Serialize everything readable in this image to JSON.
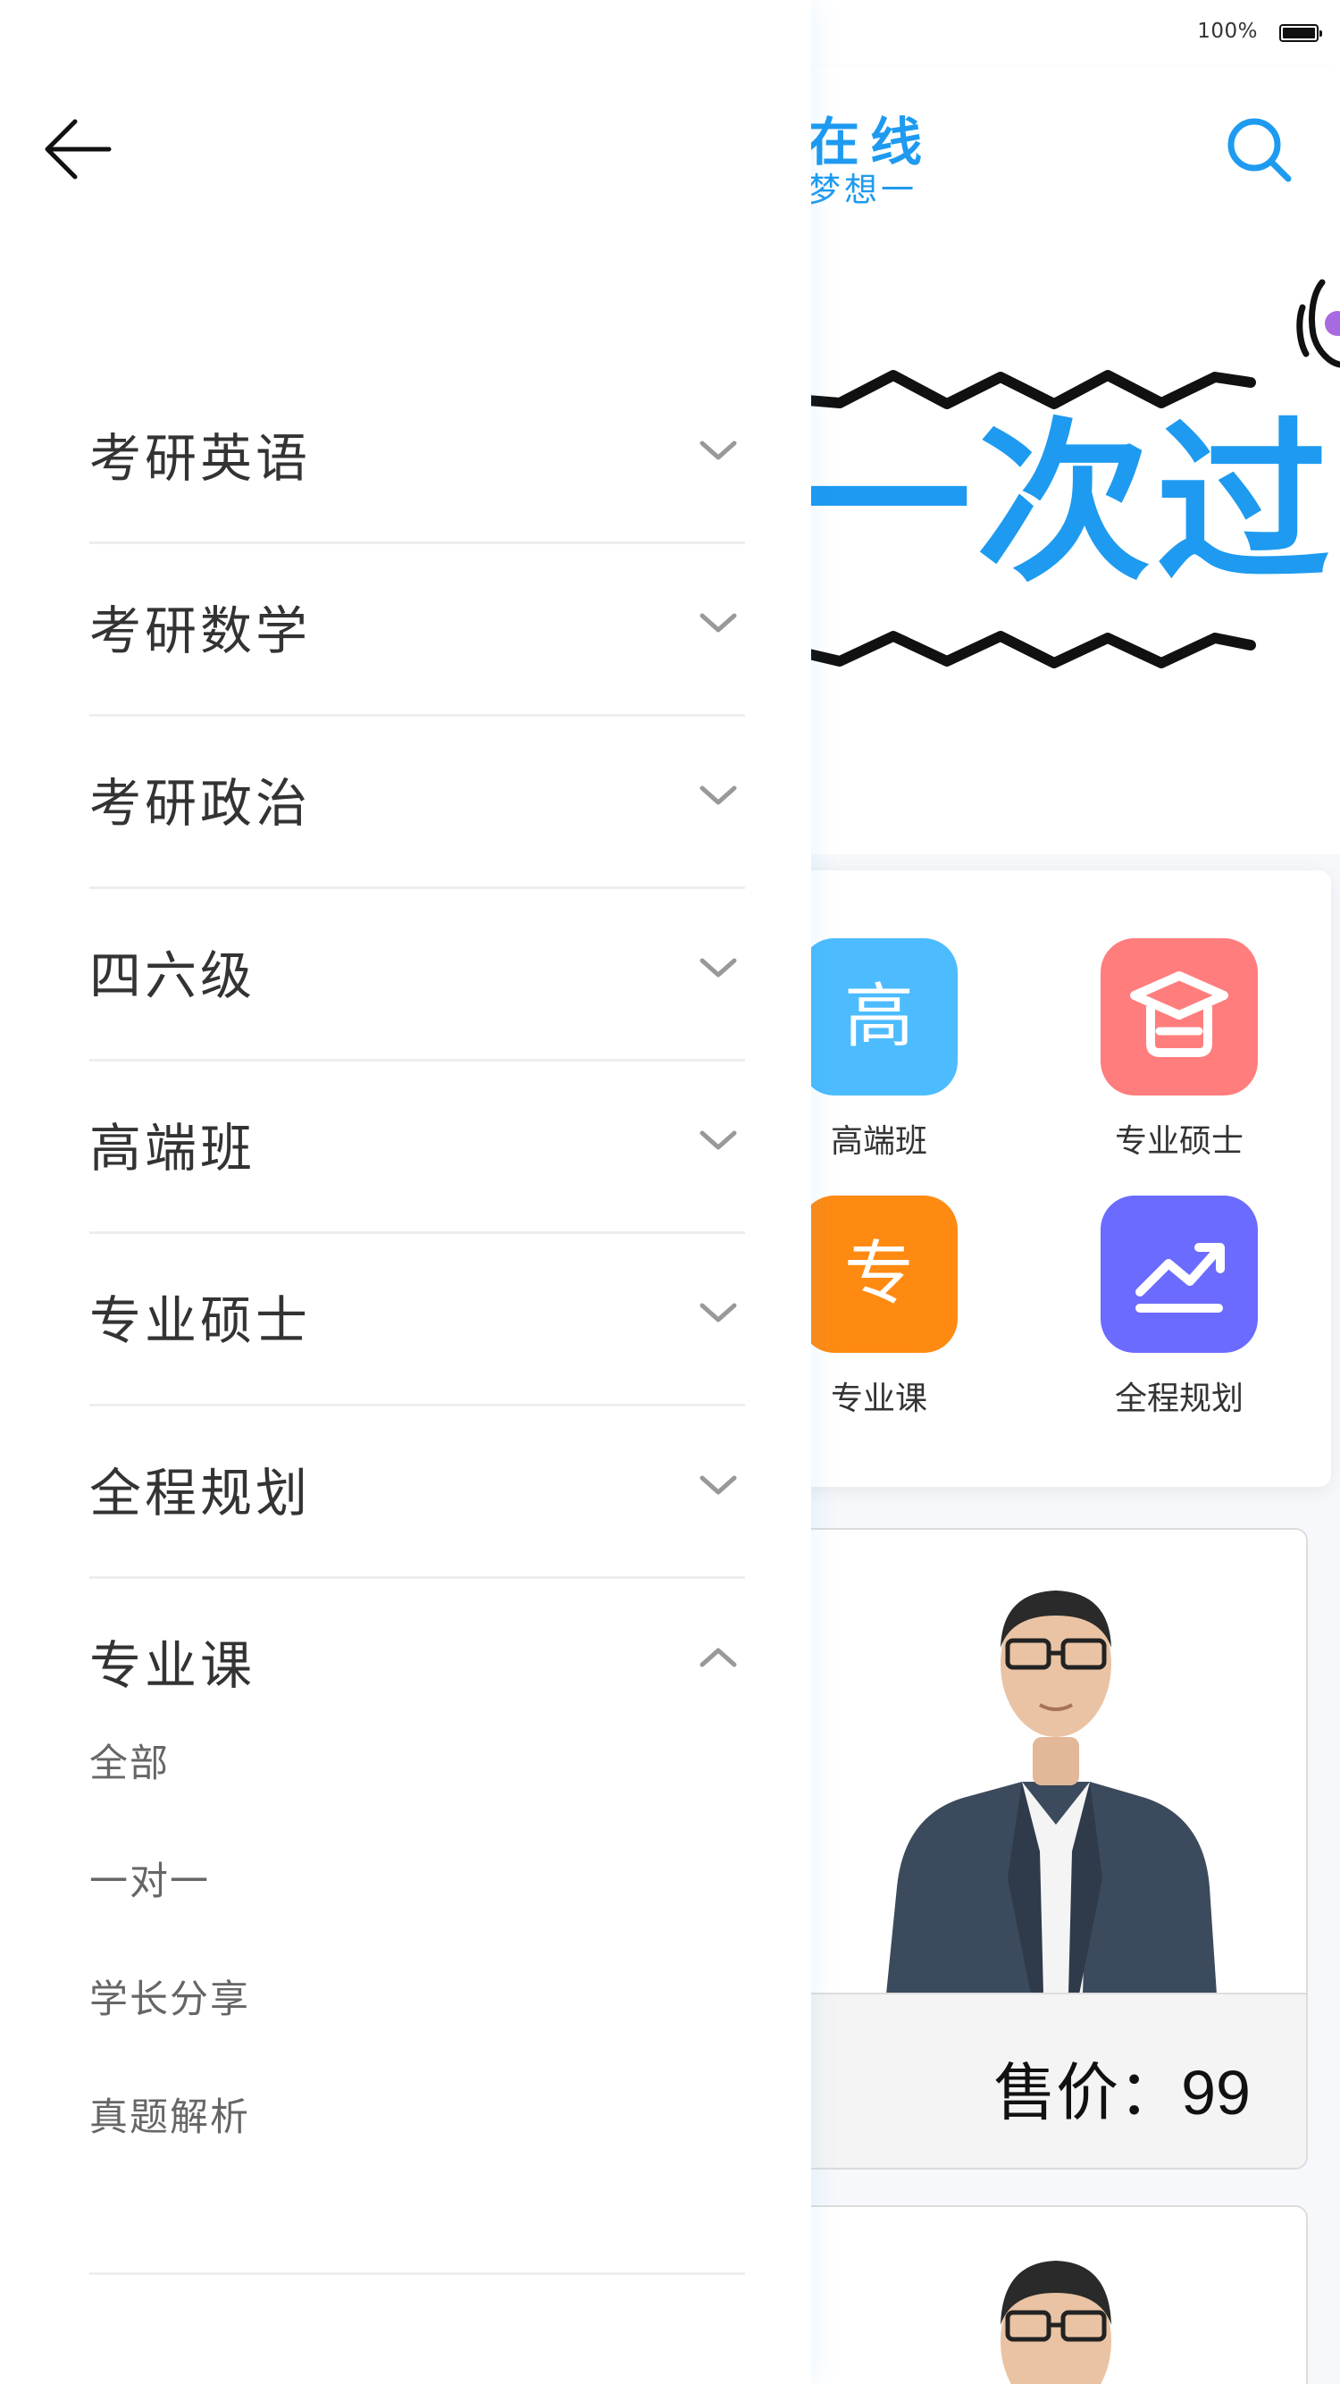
{
  "status_bar": {
    "battery_percent": "100%"
  },
  "header": {
    "logo_title": "在线",
    "logo_subtitle": "梦想一",
    "search_icon": "search-icon"
  },
  "banner": {
    "headline": "一次过"
  },
  "categories": [
    {
      "glyph": "高",
      "label": "高端班",
      "color": "#4dbcff"
    },
    {
      "glyph": "",
      "label": "专业硕士",
      "color": "#ff7d7d",
      "icon": "graduation-cap-icon"
    },
    {
      "glyph": "专",
      "label": "专业课",
      "color": "#ff8a12"
    },
    {
      "glyph": "",
      "label": "全程规划",
      "color": "#6b6bff",
      "icon": "trend-chart-icon"
    }
  ],
  "course": {
    "price_label": "售价：",
    "price_value": "99"
  },
  "drawer": {
    "back_icon": "back-arrow-icon",
    "menu": [
      {
        "label": "考研英语",
        "expanded": false
      },
      {
        "label": "考研数学",
        "expanded": false
      },
      {
        "label": "考研政治",
        "expanded": false
      },
      {
        "label": "四六级",
        "expanded": false
      },
      {
        "label": "高端班",
        "expanded": false
      },
      {
        "label": "专业硕士",
        "expanded": false
      },
      {
        "label": "全程规划",
        "expanded": false
      },
      {
        "label": "专业课",
        "expanded": true,
        "children": [
          "全部",
          "一对一",
          "学长分享",
          "真题解析"
        ]
      }
    ]
  },
  "colors": {
    "accent": "#1e9bf0",
    "text_primary": "#333333",
    "text_secondary": "#666666"
  }
}
